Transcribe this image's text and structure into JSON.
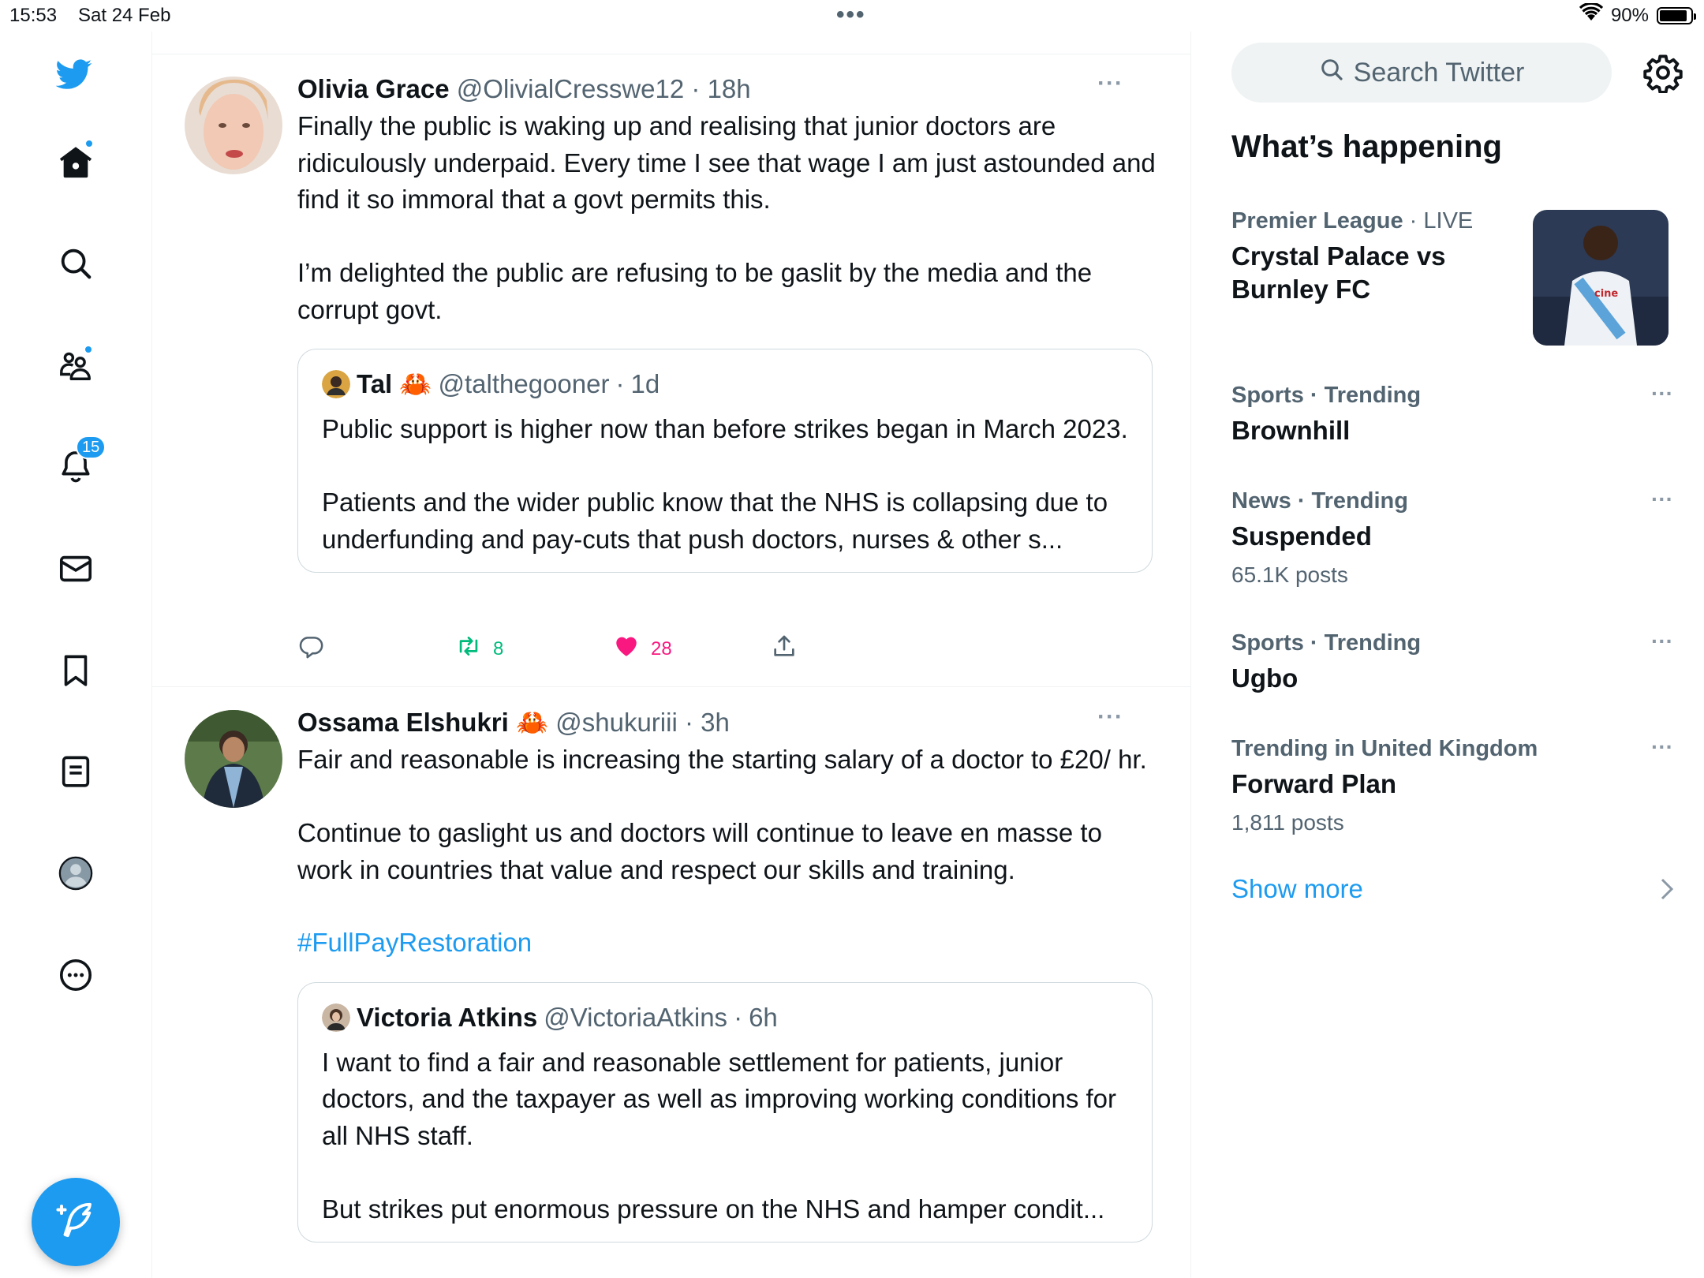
{
  "status_bar": {
    "time": "15:53",
    "date": "Sat 24 Feb",
    "battery": "90%",
    "battery_level": 0.9
  },
  "nav": {
    "notifications_badge": "15",
    "colors": {
      "accent": "#1d9bf0"
    }
  },
  "tweets": [
    {
      "name": "Olivia Grace",
      "handle": "@OlivialCresswe12",
      "sep": "·",
      "time": "18h",
      "text": "Finally the public is waking up and realising that junior doctors are ridiculously underpaid. Every time I see that wage I am just astounded and find it so immoral that a govt permits this.\n\nI’m delighted the public are refusing to be gaslit by the media and the corrupt govt.",
      "quote": {
        "name": "Tal 🦀",
        "handle": "@talthegooner",
        "sep": "·",
        "time": "1d",
        "text": "Public support is higher now than before strikes began in March 2023.\n\nPatients and the wider public know that the NHS is collapsing due to underfunding and pay-cuts that push doctors, nurses & other s..."
      },
      "retweets": "8",
      "likes": "28"
    },
    {
      "name": "Ossama Elshukri 🦀",
      "handle": "@shukuriii",
      "sep": "·",
      "time": "3h",
      "text": "Fair and reasonable is increasing the starting salary of a doctor to £20/ hr.\n\nContinue to gaslight us and doctors will continue to leave en masse to work in countries that value and respect our skills and training.",
      "hashtag": "#FullPayRestoration",
      "quote": {
        "name": "Victoria Atkins",
        "handle": "@VictoriaAtkins",
        "sep": "·",
        "time": "6h",
        "text": "I want to find a fair and reasonable settlement for patients, junior doctors, and the taxpayer as well as improving working conditions for all NHS staff.\n\nBut strikes put enormous pressure on the NHS and hamper condit..."
      }
    }
  ],
  "right": {
    "search_placeholder": "Search Twitter",
    "title": "What’s happening",
    "trends": [
      {
        "category": "Premier League",
        "suffix": " · LIVE",
        "name": "Crystal Palace vs Burnley FC"
      },
      {
        "category": "Sports · Trending",
        "name": "Brownhill"
      },
      {
        "category": "News · Trending",
        "name": "Suspended",
        "posts": "65.1K posts"
      },
      {
        "category": "Sports · Trending",
        "name": "Ugbo"
      },
      {
        "category": "Trending in United Kingdom",
        "name": "Forward Plan",
        "posts": "1,811 posts"
      }
    ],
    "show_more": "Show more"
  },
  "icons": [
    "twitter-bird-icon",
    "home-icon",
    "search-icon",
    "communities-icon",
    "bell-icon",
    "mail-icon",
    "bookmark-icon",
    "lists-icon",
    "profile-icon",
    "more-icon",
    "compose-icon",
    "reply-icon",
    "retweet-icon",
    "heart-icon",
    "share-icon",
    "gear-icon",
    "chevron-right-icon",
    "wifi-icon",
    "battery-icon"
  ]
}
